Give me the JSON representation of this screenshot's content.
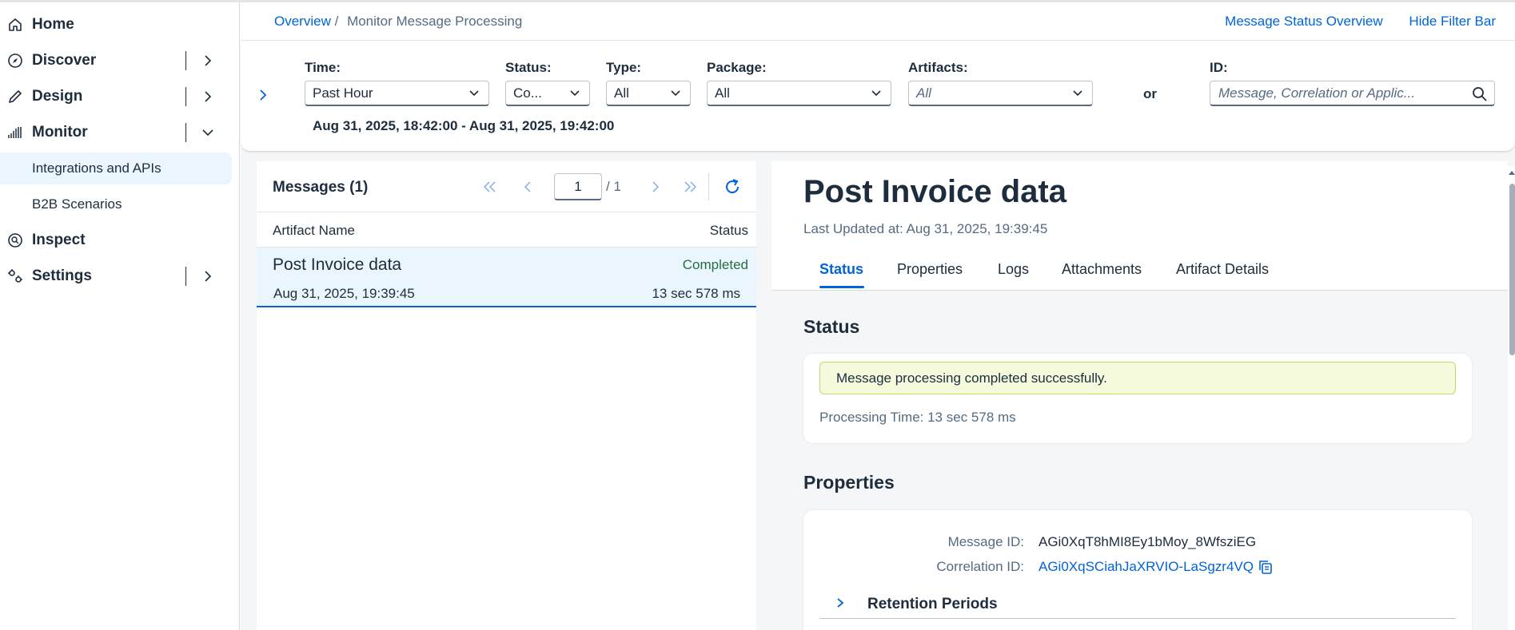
{
  "sidebar": {
    "items": [
      {
        "label": "Home",
        "icon": "home-icon"
      },
      {
        "label": "Discover",
        "icon": "compass-icon"
      },
      {
        "label": "Design",
        "icon": "pencil-icon"
      },
      {
        "label": "Monitor",
        "icon": "monitor-chart-icon"
      },
      {
        "label": "Inspect",
        "icon": "inspect-icon"
      },
      {
        "label": "Settings",
        "icon": "settings-icon"
      }
    ],
    "subitems": [
      {
        "label": "Integrations and APIs",
        "selected": true
      },
      {
        "label": "B2B Scenarios",
        "selected": false
      }
    ]
  },
  "header": {
    "breadcrumb_link": "Overview",
    "breadcrumb_separator": "/",
    "breadcrumb_current": "Monitor Message Processing",
    "link_status_overview": "Message Status Overview",
    "link_hide_filter": "Hide Filter Bar"
  },
  "filters": {
    "time_label": "Time:",
    "time_value": "Past Hour",
    "status_label": "Status:",
    "status_value": "Co...",
    "type_label": "Type:",
    "type_value": "All",
    "package_label": "Package:",
    "package_value": "All",
    "artifacts_label": "Artifacts:",
    "artifacts_value": "All",
    "or_text": "or",
    "id_label": "ID:",
    "id_placeholder": "Message, Correlation or Applic...",
    "range": "Aug 31, 2025, 18:42:00 - Aug 31, 2025, 19:42:00"
  },
  "messages": {
    "title": "Messages (1)",
    "page": "1",
    "page_of": "/ 1",
    "col_artifact": "Artifact Name",
    "col_status": "Status",
    "rows": [
      {
        "name": "Post Invoice data",
        "status": "Completed",
        "date": "Aug 31, 2025, 19:39:45",
        "duration": "13 sec 578 ms"
      }
    ]
  },
  "detail": {
    "title": "Post Invoice data",
    "updated": "Last Updated at: Aug 31, 2025, 19:39:45",
    "tabs": [
      "Status",
      "Properties",
      "Logs",
      "Attachments",
      "Artifact Details"
    ],
    "active_tab": "Status",
    "status_heading": "Status",
    "status_message": "Message processing completed successfully.",
    "processing_time": "Processing Time: 13 sec 578 ms",
    "properties_heading": "Properties",
    "message_id_label": "Message ID:",
    "message_id": "AGi0XqT8hMI8Ey1bMoy_8WfsziEG",
    "correlation_id_label": "Correlation ID:",
    "correlation_id": "AGi0XqSCiahJaXRVIO-LaSgzr4VQ",
    "retention_label": "Retention Periods"
  },
  "colors": {
    "accent": "#0064d9",
    "text": "#1d2d3e",
    "success": "#256f3a",
    "success_strip": "#f5fadc",
    "selected_row": "#ebf5fe"
  }
}
